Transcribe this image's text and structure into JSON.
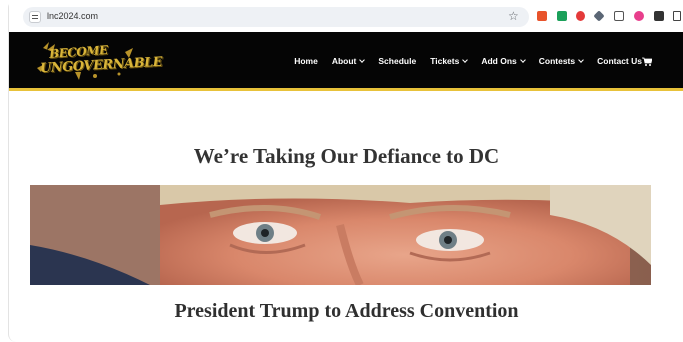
{
  "browser": {
    "url": "lnc2024.com"
  },
  "site": {
    "logo_line1": "BECOME",
    "logo_line2": "UNGOVERNABLE",
    "nav": [
      {
        "label": "Home"
      },
      {
        "label": "About"
      },
      {
        "label": "Schedule"
      },
      {
        "label": "Tickets"
      },
      {
        "label": "Add Ons"
      },
      {
        "label": "Contests"
      },
      {
        "label": "Contact Us"
      }
    ]
  },
  "main": {
    "headline": "We’re Taking Our Defiance to DC",
    "subheadline": "President Trump to Address Convention"
  },
  "colors": {
    "header_bg": "#050505",
    "accent_gold": "#e8c23a",
    "text": "#333333"
  }
}
